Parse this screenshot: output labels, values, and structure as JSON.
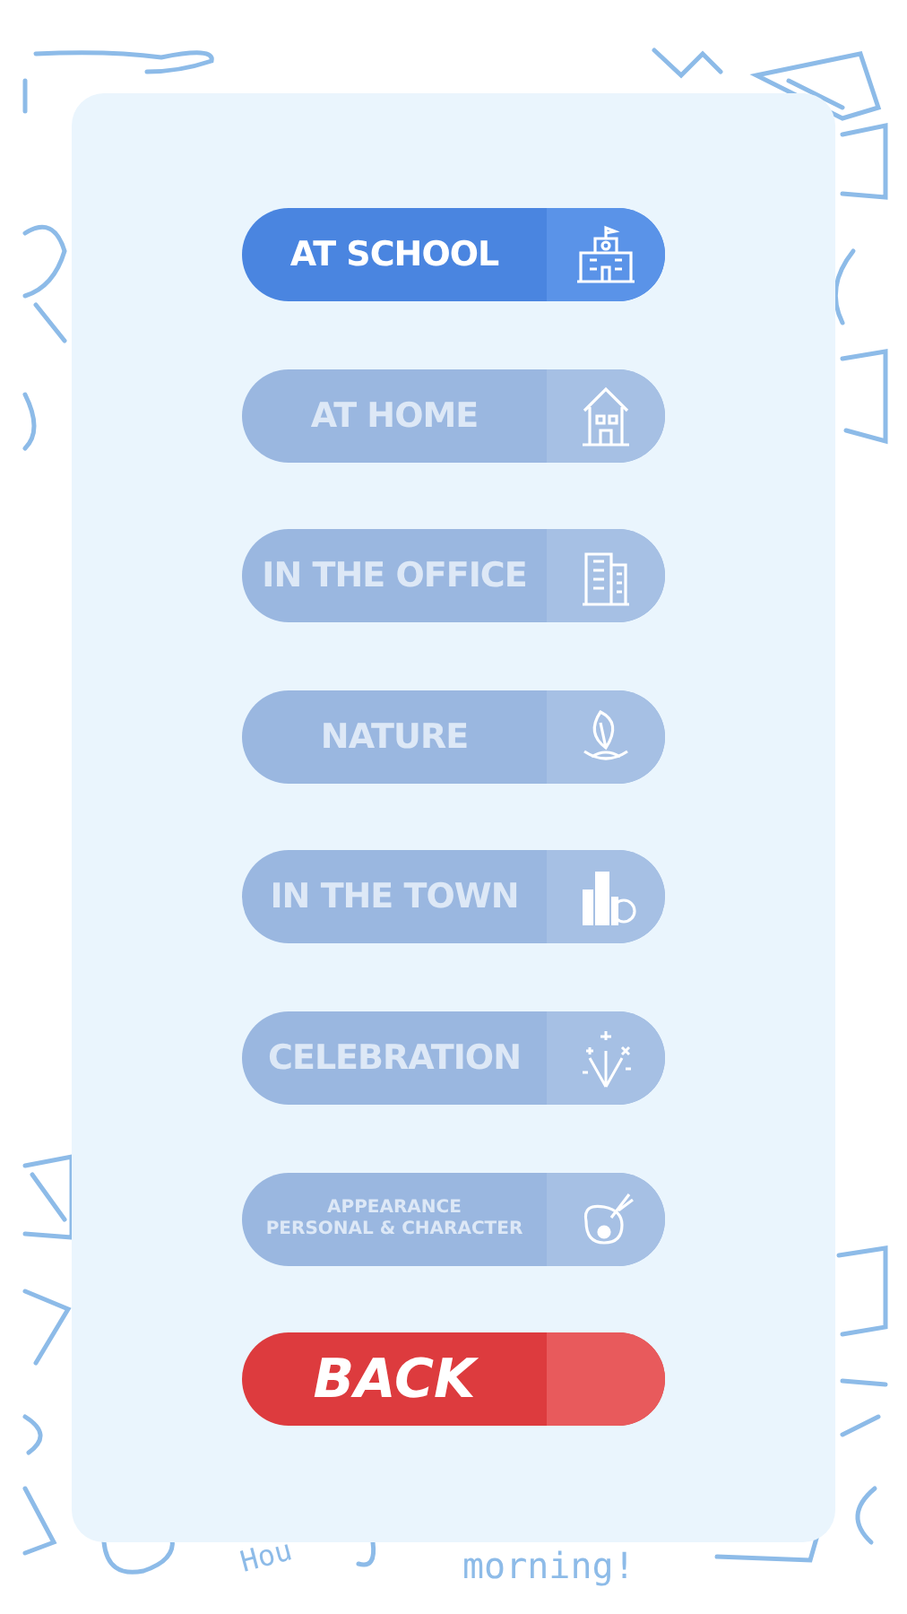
{
  "doodle_texts": [
    "Hou",
    "morning!"
  ],
  "menu": [
    {
      "kind": "category",
      "label": "AT SCHOOL",
      "selected": true
    },
    {
      "kind": "category",
      "label": "AT HOME",
      "selected": false
    },
    {
      "kind": "category",
      "label": "IN THE OFFICE",
      "selected": false
    },
    {
      "kind": "category",
      "label": "NATURE",
      "selected": false
    },
    {
      "kind": "category",
      "label": "IN THE TOWN",
      "selected": false
    },
    {
      "kind": "category",
      "label": "CELEBRATION",
      "selected": false
    },
    {
      "kind": "category",
      "label": "APPEARANCE",
      "sublabel": "PERSONAL & CHARACTER",
      "selected": false
    },
    {
      "kind": "back",
      "label": "BACK"
    }
  ]
}
